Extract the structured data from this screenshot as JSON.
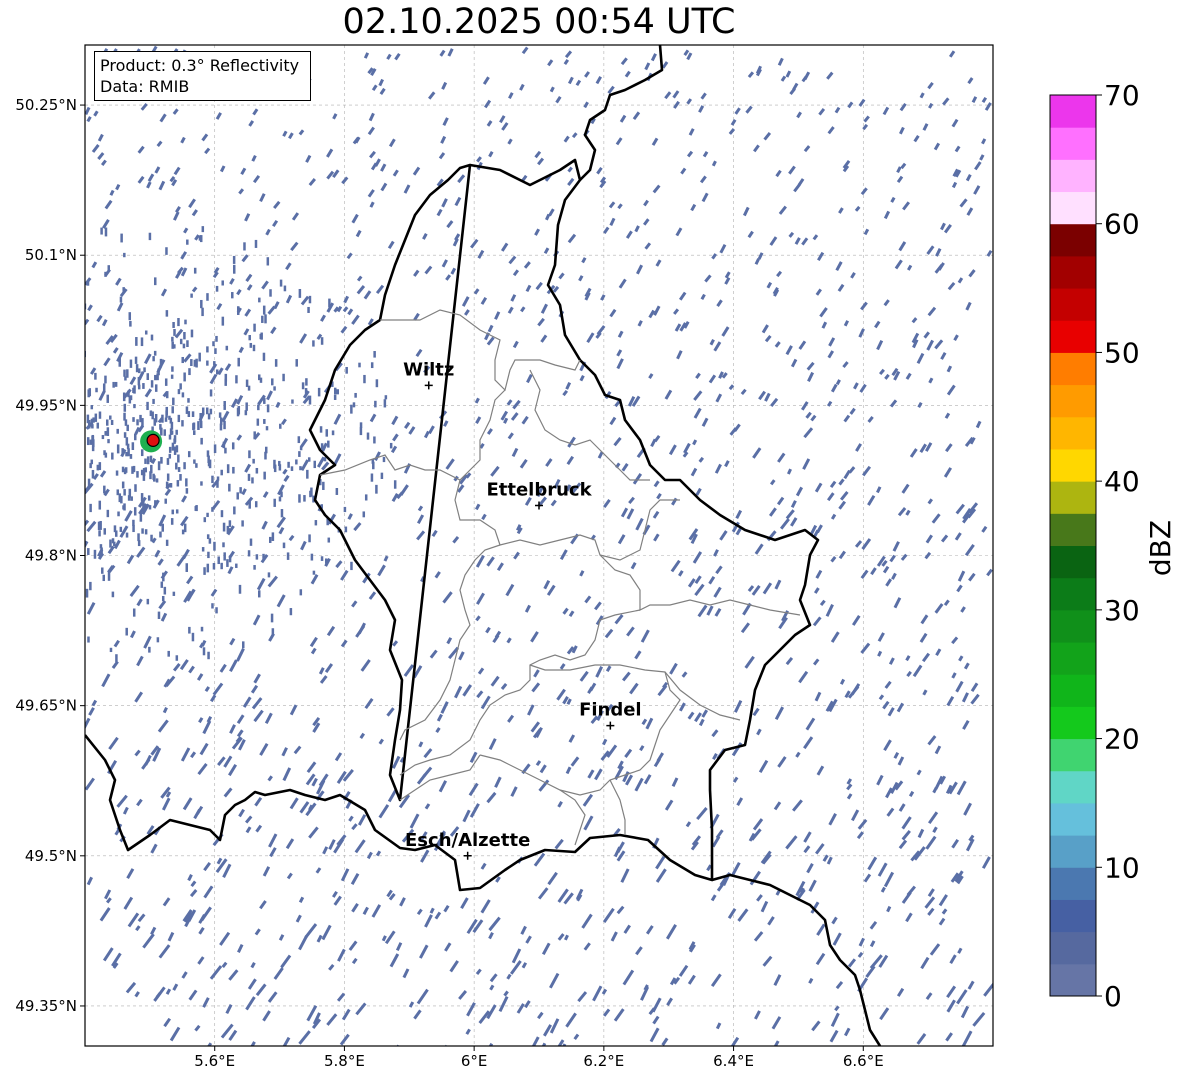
{
  "title": "02.10.2025 00:54 UTC",
  "info": {
    "product": "Product: 0.3° Reflectivity",
    "data": "Data: RMIB"
  },
  "map": {
    "lon_range": [
      5.4,
      6.8
    ],
    "lat_range": [
      49.31,
      50.31
    ],
    "lon_ticks": [
      5.6,
      5.8,
      6.0,
      6.2,
      6.4,
      6.6
    ],
    "lon_tick_labels": [
      "5.6°E",
      "5.8°E",
      "6°E",
      "6.2°E",
      "6.4°E",
      "6.6°E"
    ],
    "lat_ticks": [
      50.25,
      50.1,
      49.95,
      49.8,
      49.65,
      49.5,
      49.35
    ],
    "lat_tick_labels": [
      "50.25°N",
      "50.1°N",
      "49.95°N",
      "49.8°N",
      "49.65°N",
      "49.5°N",
      "49.35°N"
    ],
    "grid": true,
    "cities": [
      {
        "name": "Wiltz",
        "lon": 5.93,
        "lat": 49.97
      },
      {
        "name": "Ettelbruck",
        "lon": 6.1,
        "lat": 49.85
      },
      {
        "name": "Findel",
        "lon": 6.21,
        "lat": 49.63
      },
      {
        "name": "Esch/Alzette",
        "lon": 5.99,
        "lat": 49.5
      }
    ],
    "radar_site": {
      "lon": 5.505,
      "lat": 49.915
    }
  },
  "colorbar": {
    "label": "dBZ",
    "min": 0,
    "max": 70,
    "tick_values": [
      0,
      10,
      20,
      30,
      40,
      50,
      60,
      70
    ],
    "tick_labels": [
      "0",
      "10",
      "20",
      "30",
      "40",
      "50",
      "60",
      "70"
    ],
    "colors": [
      "#6675a6",
      "#56699f",
      "#4660a3",
      "#4b78b0",
      "#58a0c8",
      "#65c0dc",
      "#60d6c6",
      "#40d470",
      "#14c91c",
      "#10b51a",
      "#12a31a",
      "#10901a",
      "#0c7c18",
      "#0a6412",
      "#48781a",
      "#adb510",
      "#ffd700",
      "#ffb600",
      "#ff9b00",
      "#ff7d00",
      "#e80000",
      "#c40000",
      "#a20000",
      "#7b0000",
      "#ffe0ff",
      "#ffb3ff",
      "#ff70ff",
      "#ec36ec"
    ]
  }
}
